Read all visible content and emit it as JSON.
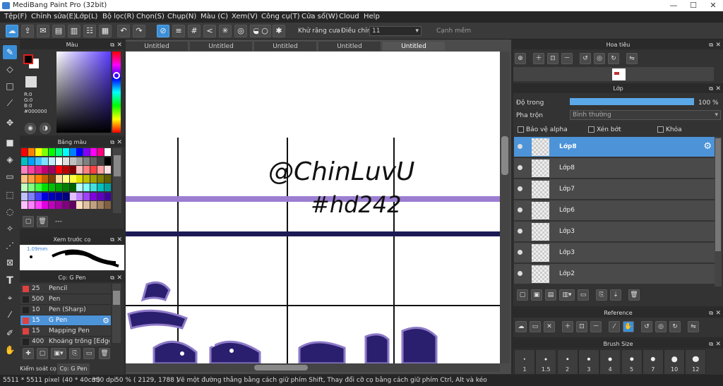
{
  "window": {
    "title": "MediBang Paint Pro (32bit)",
    "minimize": "—",
    "maximize": "☐",
    "close": "✕"
  },
  "menu": [
    "Tệp(F)",
    "Chỉnh sửa(E)",
    "Lớp(L)",
    "Bộ lọc(R)",
    "Chọn(S)",
    "Chụp(N)",
    "Màu (C)",
    "Xem(V)",
    "Công cụ(T)",
    "Cửa sổ(W)",
    "Cloud",
    "Help"
  ],
  "toolbar": {
    "antialias_label": "Khử răng cưa",
    "adjust_label": "Điều chỉnh",
    "adjust_value": "11",
    "sharp_edge_label": "Cạnh mềm"
  },
  "tabs": [
    "Untitled",
    "Untitled",
    "Untitled",
    "Untitled",
    "Untitled"
  ],
  "color_panel": {
    "title": "Màu",
    "r": "R:0",
    "g": "G:0",
    "b": "B:0",
    "hex": "#000000",
    "primary": "#000000",
    "secondary": "#ffffff"
  },
  "palette_panel": {
    "title": "Bảng màu",
    "footer_text": "---"
  },
  "brush_preview": {
    "title": "Xem trước cọ",
    "size": "1.09mm"
  },
  "brush_panel": {
    "title": "Cọ: G Pen",
    "items": [
      {
        "size": "25",
        "name": "Pencil",
        "color": "#e04040"
      },
      {
        "size": "500",
        "name": "Pen",
        "color": "#222222"
      },
      {
        "size": "10",
        "name": "Pen (Sharp)",
        "color": "#222222"
      },
      {
        "size": "15",
        "name": "G Pen",
        "color": "#e04040"
      },
      {
        "size": "15",
        "name": "Mapping Pen",
        "color": "#e04040"
      },
      {
        "size": "400",
        "name": "Khoảng trống [Edge",
        "color": "#222222"
      }
    ],
    "bottom_tabs": [
      "Kiểm soát cọ",
      "Cọ: G Pen"
    ]
  },
  "navigator": {
    "title": "Hoa tiêu"
  },
  "layer_panel": {
    "title": "Lớp",
    "opacity_label": "Độ trong",
    "opacity_value": "100 %",
    "opacity_fraction": 1.0,
    "blend_label": "Pha trộn",
    "blend_value": "Bình thường",
    "protect_alpha": "Bảo vệ alpha",
    "clipping": "Xén bớt",
    "lock": "Khóa",
    "layers": [
      "Lớp8",
      "Lớp8",
      "Lớp7",
      "Lớp6",
      "Lớp3",
      "Lớp3",
      "Lớp2"
    ]
  },
  "reference": {
    "title": "Reference"
  },
  "brush_size": {
    "title": "Brush Size",
    "sizes": [
      "1",
      "1.5",
      "2",
      "3",
      "4",
      "5",
      "7",
      "10",
      "12"
    ]
  },
  "canvas_text": {
    "line1": "@ChinLuvU",
    "line2": "#hd242"
  },
  "status": {
    "dimensions": "5511 * 5511 pixel",
    "physical": "(40 * 40cm)",
    "dpi": "350 dpi",
    "zoom": "50 %",
    "cursor": "( 2129, 1788 )",
    "hint": "Vẽ một đường thẳng bằng cách giữ phím Shift, Thay đổi cỡ cọ bằng cách giữ phím Ctrl, Alt và kéo"
  },
  "colors": {
    "accent": "#4c93d8",
    "purple_stroke": "#9b7ed1",
    "navy_stroke": "#1c1a55",
    "ink_blue": "#2a1f6e"
  }
}
